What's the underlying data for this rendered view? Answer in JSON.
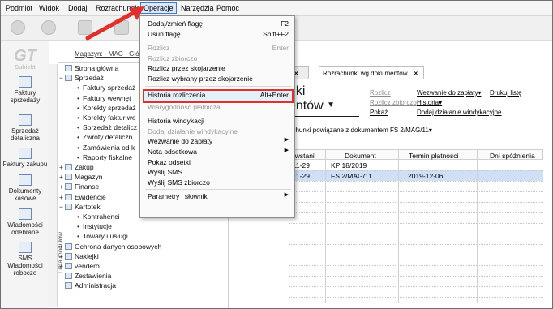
{
  "menubar": {
    "items": [
      "Podmiot",
      "Widok",
      "Dodaj",
      "Rozrachunek",
      "Operacje",
      "Narzędzia",
      "Pomoc"
    ],
    "active": "Operacje"
  },
  "leftnav": {
    "logo": "Subiekt",
    "items": [
      {
        "label": "Faktury sprzedaży",
        "icon": "invoice-icon"
      },
      {
        "label": "Sprzedaż detaliczna",
        "icon": "retail-icon"
      },
      {
        "label": "Faktury zakupu",
        "icon": "purchase-icon"
      },
      {
        "label": "Dokumenty kasowe",
        "icon": "cash-documents-icon"
      },
      {
        "label": "Wiadomości odebrane",
        "icon": "inbox-icon"
      },
      {
        "label": "SMS Wiadomości robocze",
        "icon": "sms-icon"
      }
    ],
    "side_tab": "Lista modułów"
  },
  "magazyn": "Magazyn: - MAG - Głó",
  "tree": [
    {
      "label": "Strona główna",
      "level": 0,
      "expander": ""
    },
    {
      "label": "Sprzedaż",
      "level": 0,
      "expander": "−"
    },
    {
      "label": "Faktury sprzedaż",
      "level": 1
    },
    {
      "label": "Faktury wewnęt",
      "level": 1
    },
    {
      "label": "Korekty sprzedaż",
      "level": 1
    },
    {
      "label": "Korekty faktur we",
      "level": 1
    },
    {
      "label": "Sprzedaż detalicz",
      "level": 1
    },
    {
      "label": "Zwroty detaliczn",
      "level": 1
    },
    {
      "label": "Zamówienia od k",
      "level": 1
    },
    {
      "label": "Raporty fiskalne",
      "level": 1
    },
    {
      "label": "Zakup",
      "level": 0,
      "expander": "+"
    },
    {
      "label": "Magazyn",
      "level": 0,
      "expander": "+"
    },
    {
      "label": "Finanse",
      "level": 0,
      "expander": "+"
    },
    {
      "label": "Ewidencje",
      "level": 0,
      "expander": "+"
    },
    {
      "label": "Kartoteki",
      "level": 0,
      "expander": "−"
    },
    {
      "label": "Kontrahenci",
      "level": 1
    },
    {
      "label": "Instytucje",
      "level": 1
    },
    {
      "label": "Towary i usługi",
      "level": 1
    },
    {
      "label": "Ochrona danych osobowych",
      "level": 0,
      "expander": "+"
    },
    {
      "label": "Naklejki",
      "level": 0,
      "expander": "+"
    },
    {
      "label": "vendero",
      "level": 0,
      "expander": "+"
    },
    {
      "label": "Zestawienia",
      "level": 0,
      "expander": ""
    },
    {
      "label": "Administracja",
      "level": 0,
      "expander": ""
    }
  ],
  "tabs": [
    {
      "label": "y",
      "active": false
    },
    {
      "label": "Rozrachunki wg dokumentów",
      "active": true
    }
  ],
  "heading": {
    "line1": "nki",
    "line2": "entów"
  },
  "links": {
    "rozlicz": "Rozlicz",
    "rozlicz_zbiorczo": "Rozlicz zbiorczo",
    "pokaz": "Pokaż",
    "wezwanie": "Wezwanie do zapłaty",
    "historia": "Historia",
    "dodaj_dzialanie": "Dodaj działanie windykacyjne",
    "drukuj": "Drukuj listę"
  },
  "subtitle": "achunki powiązane z dokumentem FS 2/MAG/11",
  "grid": {
    "columns": [
      "owstani",
      "Dokument",
      "Termin płatności",
      "Dni spóźnienia"
    ],
    "rows": [
      {
        "date": "-11-29",
        "document": "KP 18/2019",
        "due": "",
        "late": "",
        "selected": false
      },
      {
        "date": "-11-29",
        "document": "FS 2/MAG/11",
        "due": "2019-12-06",
        "late": "",
        "selected": true
      }
    ]
  },
  "dropdown": {
    "items": [
      {
        "label": "Dodaj/zmień flagę",
        "shortcut": "F2",
        "disabled": false
      },
      {
        "label": "Usuń flagę",
        "shortcut": "Shift+F2",
        "disabled": false
      },
      {
        "sep": true
      },
      {
        "label": "Rozlicz",
        "shortcut": "Enter",
        "disabled": true
      },
      {
        "label": "Rozlicz zbiorczo",
        "shortcut": "",
        "disabled": true
      },
      {
        "label": "Rozlicz przez skojarzenie",
        "shortcut": "",
        "disabled": false
      },
      {
        "label": "Rozlicz wybrany przez skojarzenie",
        "shortcut": "",
        "disabled": false
      },
      {
        "sep": true
      },
      {
        "label": "Historia rozliczenia",
        "shortcut": "Alt+Enter",
        "disabled": false,
        "highlight": true
      },
      {
        "label": "Wiarygodność płatnicza",
        "shortcut": "",
        "disabled": true
      },
      {
        "sep": true
      },
      {
        "label": "Historia windykacji",
        "shortcut": "",
        "disabled": false
      },
      {
        "label": "Dodaj działanie windykacyjne",
        "shortcut": "",
        "disabled": true
      },
      {
        "label": "Wezwanie do zapłaty",
        "shortcut": "",
        "disabled": false,
        "submenu": true
      },
      {
        "label": "Nota odsetkowa",
        "shortcut": "",
        "disabled": false,
        "submenu": true
      },
      {
        "label": "Pokaż odsetki",
        "shortcut": "",
        "disabled": false
      },
      {
        "label": "Wyślij SMS",
        "shortcut": "",
        "disabled": false
      },
      {
        "label": "Wyślij SMS zbiorczo",
        "shortcut": "",
        "disabled": false
      },
      {
        "sep": true
      },
      {
        "label": "Parametry i słowniki",
        "shortcut": "",
        "disabled": false,
        "submenu": true
      }
    ]
  },
  "colors": {
    "highlight_border": "#e0302c",
    "arrow": "#e0302c",
    "selection": "#cfe0f6"
  }
}
